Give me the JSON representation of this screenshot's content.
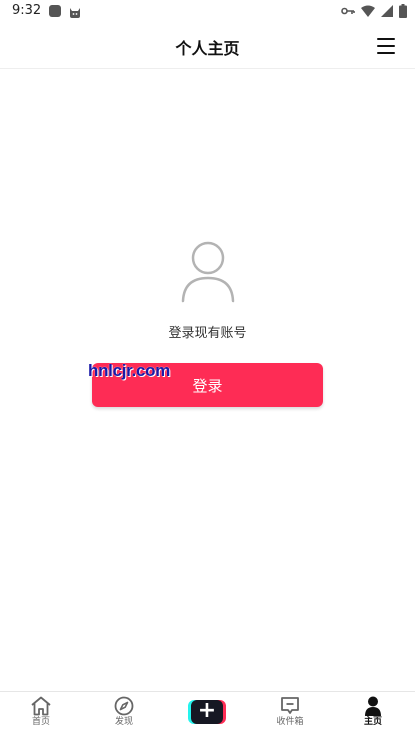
{
  "status_bar": {
    "time": "9:32",
    "icons": [
      "app-square-icon",
      "cat-icon",
      "key-icon",
      "wifi-icon",
      "signal-icon",
      "battery-icon"
    ]
  },
  "header": {
    "title": "个人主页",
    "menu_icon": "hamburger-menu-icon"
  },
  "main": {
    "avatar_icon": "user-placeholder-icon",
    "prompt": "登录现有账号",
    "login_button_label": "登录",
    "watermark": "hnlcjr.com"
  },
  "bottom_nav": {
    "items": [
      {
        "label": "首页",
        "icon": "home-icon"
      },
      {
        "label": "发现",
        "icon": "compass-icon"
      },
      {
        "label": "",
        "icon": "plus-icon"
      },
      {
        "label": "收件箱",
        "icon": "message-icon"
      },
      {
        "label": "主页",
        "icon": "person-icon"
      }
    ],
    "active_index": 4
  },
  "colors": {
    "primary": "#fe2c55",
    "cyan": "#25f4ee",
    "dark": "#161823",
    "watermark": "#1a1aa8"
  }
}
